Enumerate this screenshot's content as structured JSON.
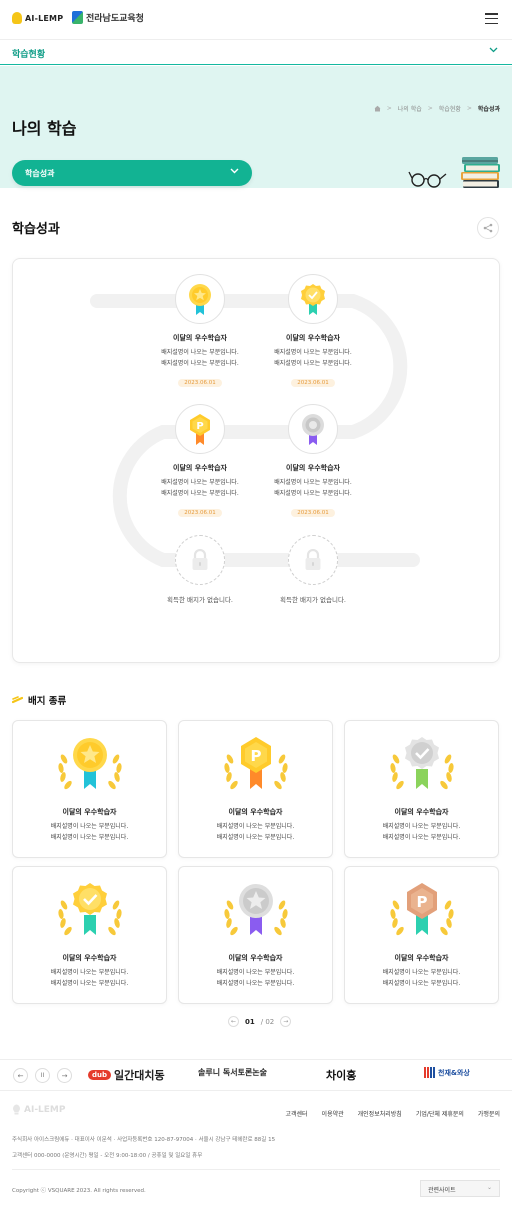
{
  "header": {
    "logo_ai": "AI-LEMP",
    "logo_edu": "전라남도교육청",
    "menu_icon": "hamburger-menu-icon"
  },
  "section_bar": {
    "label": "학습현황"
  },
  "hero": {
    "title": "나의 학습",
    "breadcrumbs": [
      "나의 학습",
      "학습현황",
      "학습성과"
    ],
    "select_value": "학습성과"
  },
  "main": {
    "heading": "학습성과"
  },
  "board": {
    "nodes": [
      {
        "title": "이달의 우수학습자",
        "desc1": "배지설명이 나오는 부분입니다.",
        "desc2": "배지설명이 나오는 부분입니다.",
        "date": "2023.06.01",
        "badge": "gold-ribbon-medal"
      },
      {
        "title": "이달의 우수학습자",
        "desc1": "배지설명이 나오는 부분입니다.",
        "desc2": "배지설명이 나오는 부분입니다.",
        "date": "2023.06.01",
        "badge": "gold-check-medal"
      },
      {
        "title": "이달의 우수학습자",
        "desc1": "배지설명이 나오는 부분입니다.",
        "desc2": "배지설명이 나오는 부분입니다.",
        "date": "2023.06.01",
        "badge": "gold-p-medal"
      },
      {
        "title": "이달의 우수학습자",
        "desc1": "배지설명이 나오는 부분입니다.",
        "desc2": "배지설명이 나오는 부분입니다.",
        "date": "2023.06.01",
        "badge": "silver-medal"
      }
    ],
    "empty_text": "획득한 배지가 없습니다."
  },
  "badge_types": {
    "heading": "배지 종류",
    "cards": [
      {
        "title": "이달의 우수학습자",
        "desc1": "배지설명이 나오는 부분입니다.",
        "desc2": "배지설명이 나오는 부분입니다.",
        "badge": "gold-star-medal"
      },
      {
        "title": "이달의 우수학습자",
        "desc1": "배지설명이 나오는 부분입니다.",
        "desc2": "배지설명이 나오는 부분입니다.",
        "badge": "gold-p-medal"
      },
      {
        "title": "이달의 우수학습자",
        "desc1": "배지설명이 나오는 부분입니다.",
        "desc2": "배지설명이 나오는 부분입니다.",
        "badge": "silver-check-medal"
      },
      {
        "title": "이달의 우수학습자",
        "desc1": "배지설명이 나오는 부분입니다.",
        "desc2": "배지설명이 나오는 부분입니다.",
        "badge": "gold-check-medal"
      },
      {
        "title": "이달의 우수학습자",
        "desc1": "배지설명이 나오는 부분입니다.",
        "desc2": "배지설명이 나오는 부분입니다.",
        "badge": "silver-star-medal"
      },
      {
        "title": "이달의 우수학습자",
        "desc1": "배지설명이 나오는 부분입니다.",
        "desc2": "배지설명이 나오는 부분입니다.",
        "badge": "bronze-p-medal"
      }
    ],
    "pager": {
      "current": "01",
      "total": "/ 02"
    }
  },
  "partners": {
    "pause_icon": "II",
    "logos": [
      {
        "badge": "dub",
        "name": "일간대치동"
      },
      {
        "badge": "",
        "name": "솔루니 독서토론논술"
      },
      {
        "badge": "",
        "name": "차이홍"
      },
      {
        "badge": "",
        "name": "천재&와상"
      }
    ]
  },
  "footer": {
    "logo": "AI-LEMP",
    "links": [
      "고객센터",
      "이용약관",
      "개인정보처리방침",
      "기업/단체 제휴문의",
      "가맹문의"
    ],
    "info1": "주식회사 아이스크림에듀  ·  대표이사 이문석  ·  사업자등록번호 120-87-97004  ·  서울시 강남구 테헤란로 88길 15",
    "info2": "고객센터 000-0000 (운영시간) 평일 - 오전 9:00-18:00 / 공휴일 및 일요일 휴무",
    "copyright": "Copyright ⓒ VSQUARE 2023. All rights reserved.",
    "related_site": "관련사이트"
  },
  "colors": {
    "accent": "#12b393",
    "hero_bg": "#dff5f1",
    "date_text": "#e69a3a"
  }
}
